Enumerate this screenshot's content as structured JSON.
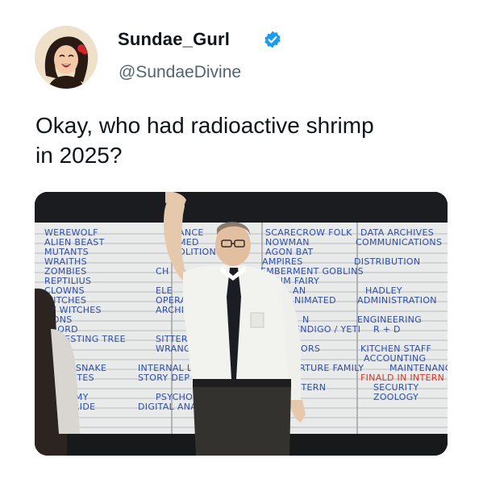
{
  "user": {
    "display_name": "Sundae_Gurl",
    "handle": "@SundaeDivine",
    "verified": true,
    "avatar_icon": "profile-avatar"
  },
  "tweet": {
    "text_line1": "Okay, who had radioactive shrimp",
    "text_line2": "in 2025?"
  },
  "media": {
    "board": {
      "col1": [
        "WEREWOLF",
        "ALIEN BEAST",
        "MUTANTS",
        "WRAITHS",
        "ZOMBIES",
        "REPTILIUS",
        "CLOWNS",
        "WITCHES",
        "XY WITCHES",
        "MONS",
        "L LORD",
        "MOLESTING TREE",
        "T SNAKE",
        "DITES",
        "IN",
        "MMY",
        "BRIDE"
      ],
      "col2": [
        "ANCE",
        "MED",
        "OLITION",
        "CH",
        "ELE",
        "OPERA",
        "ARCHIV",
        "SITTERS",
        "WRANG",
        "INTERNAL LO",
        "STORY DEP",
        "PSYCHOL",
        "DIGITAL ANA"
      ],
      "col3": [
        "SCARECROW FOLK",
        "NOWMAN",
        "AGON BAT",
        "AMPIRES",
        "EMBERMENT GOBLINS",
        "LUM FAIRY",
        "AN",
        "NIMATED",
        "N",
        "ENDIGO / YETI",
        "ORS",
        "TORTURE FAMILY",
        "NTERN"
      ],
      "col4": [
        "DATA ARCHIVES",
        "COMMUNICATIONS",
        "DISTRIBUTION",
        "HADLEY",
        "ADMINISTRATION",
        "ENGINEERING",
        "R + D",
        "KITCHEN STAFF",
        "ACCOUNTING",
        "MAINTENANCE",
        "FINALD IN INTERN",
        "SECURITY",
        "ZOOLOGY"
      ]
    }
  },
  "colors": {
    "verified": "#1d9bf0",
    "text": "#0f1419",
    "secondary": "#536471",
    "marker": "#2f4fa8",
    "marker_red": "#d23a2a"
  }
}
